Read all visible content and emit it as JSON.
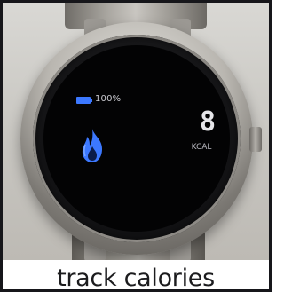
{
  "watch": {
    "battery": {
      "icon": "battery-icon",
      "level_text": "100%"
    },
    "activity": {
      "icon": "flame-icon",
      "icon_color": "#3c78ff",
      "calories_value": "8",
      "calories_unit": "KCAL"
    }
  },
  "caption": {
    "text": "track calories"
  },
  "colors": {
    "screen": "#030304",
    "accent_blue": "#3c78ff",
    "text_light": "#e6e6ea"
  }
}
